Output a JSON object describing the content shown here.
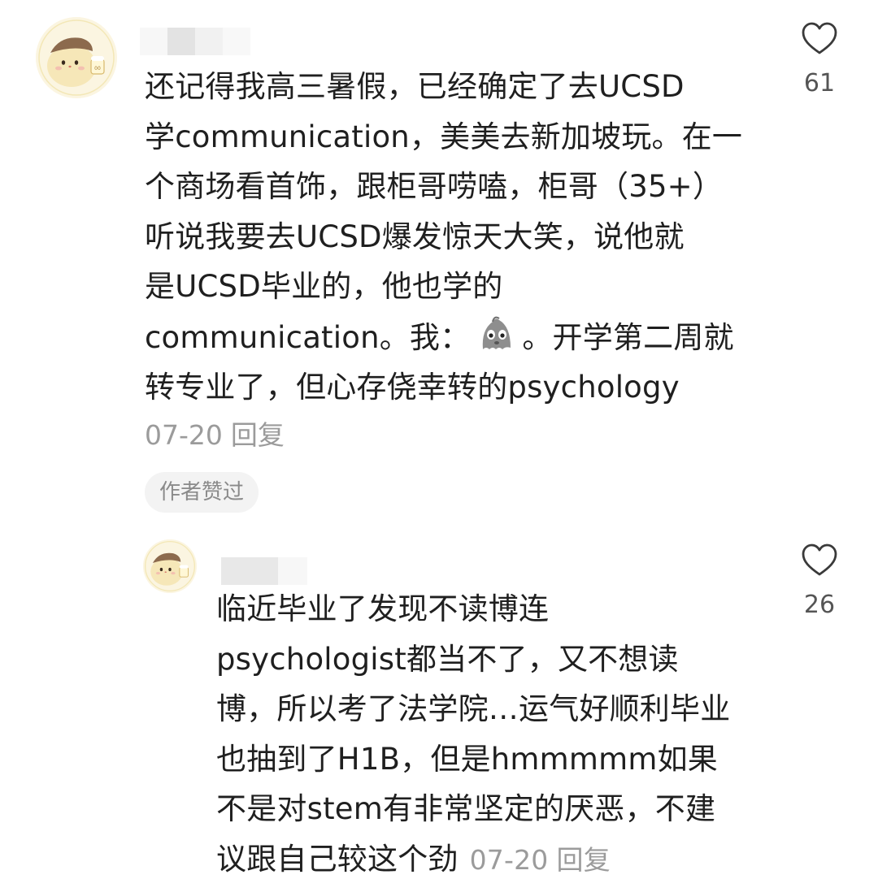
{
  "comment": {
    "lines": [
      "还记得我高三暑假，已经确定了去UCSD",
      "学communication，美美去新加坡玩。在一",
      "个商场看首饰，跟柜哥唠嗑，柜哥（35+）",
      "听说我要去UCSD爆发惊天大笑，说他就",
      "是UCSD毕业的，他也学的"
    ],
    "line6_before_emoji": "communication。我：",
    "line6_after_emoji": "。开学第二周就",
    "line7": "转专业了，但心存侥幸转的psychology",
    "date": "07-20",
    "reply_label": "回复",
    "author_badge": "作者赞过",
    "like_count": "61"
  },
  "reply": {
    "lines": [
      "临近毕业了发现不读博连",
      "psychologist都当不了，又不想读",
      "博，所以考了法学院…运气好顺利毕业",
      "也抽到了H1B，但是hmmmmm如果",
      "不是对stem有非常坚定的厌恶，不建"
    ],
    "last_line": "议跟自己较这个劲",
    "date": "07-20",
    "reply_label": "回复",
    "like_count": "26"
  },
  "colors": {
    "text": "#1f1f1f",
    "meta": "#9b9b9b",
    "badge_bg": "#f3f3f3",
    "heart_stroke": "#3a3a3a",
    "avatar_bg": "#fbf5e1"
  },
  "icons": {
    "avatar": "hamster-avatar-icon",
    "like": "heart-outline-icon",
    "emoji": "grey-ghost-emoji-icon"
  }
}
